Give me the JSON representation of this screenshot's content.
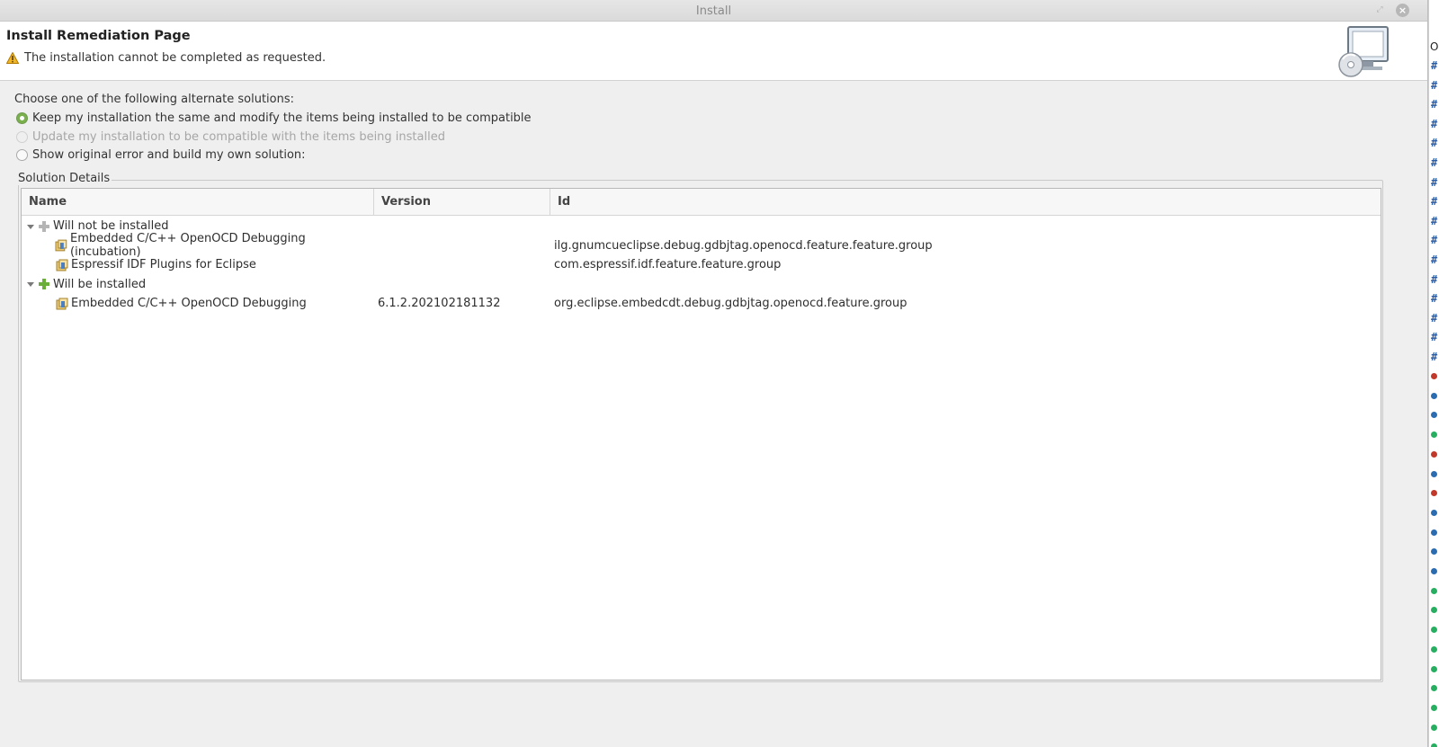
{
  "window": {
    "title": "Install"
  },
  "banner": {
    "page_title": "Install Remediation Page",
    "message": "The installation cannot be completed as requested."
  },
  "solutions": {
    "prompt": "Choose one of the following alternate solutions:",
    "options": [
      {
        "label": "Keep my installation the same and modify the items being installed to be compatible",
        "selected": true,
        "enabled": true
      },
      {
        "label": "Update my installation to be compatible with the items being installed",
        "selected": false,
        "enabled": false
      },
      {
        "label": "Show original error and build my own solution:",
        "selected": false,
        "enabled": true
      }
    ]
  },
  "details": {
    "group_label": "Solution Details",
    "columns": [
      "Name",
      "Version",
      "Id"
    ],
    "groups": [
      {
        "label": "Will not be installed",
        "icon": "grey-plus-icon",
        "items": [
          {
            "name": "Embedded C/C++ OpenOCD Debugging (incubation)",
            "version": "",
            "id": "ilg.gnumcueclipse.debug.gdbjtag.openocd.feature.feature.group"
          },
          {
            "name": "Espressif IDF Plugins for Eclipse",
            "version": "",
            "id": "com.espressif.idf.feature.feature.group"
          }
        ]
      },
      {
        "label": "Will be installed",
        "icon": "green-plus-icon",
        "items": [
          {
            "name": "Embedded C/C++ OpenOCD Debugging",
            "version": "6.1.2.202102181132",
            "id": "org.eclipse.embedcdt.debug.gdbjtag.openocd.feature.group"
          }
        ]
      }
    ]
  },
  "background": {
    "edge_text": "Or"
  }
}
